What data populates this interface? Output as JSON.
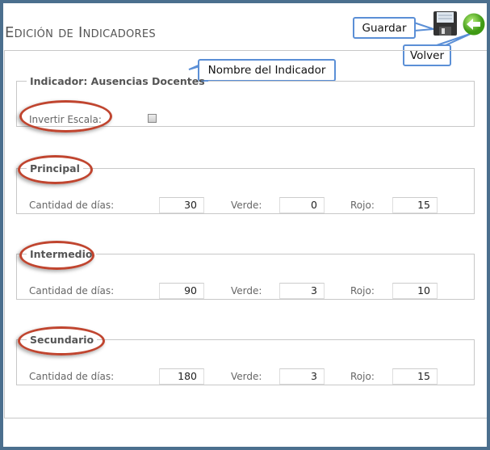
{
  "header": {
    "title": "Edición de Indicadores"
  },
  "toolbar": {
    "save_icon": "floppy-disk-icon",
    "back_icon": "green-back-arrow-icon"
  },
  "callouts": {
    "save": "Guardar",
    "back": "Volver",
    "indicator_name": "Nombre del Indicador"
  },
  "indicator": {
    "legend": "Indicador: Ausencias Docentes",
    "invert_label": "Invertir Escala:",
    "invert_checked": false
  },
  "labels": {
    "days": "Cantidad de días:",
    "green": "Verde:",
    "red": "Rojo:"
  },
  "sections": [
    {
      "legend": "Principal",
      "days": "30",
      "green": "0",
      "red": "15"
    },
    {
      "legend": "Intermedio",
      "days": "90",
      "green": "3",
      "red": "10"
    },
    {
      "legend": "Secundario",
      "days": "180",
      "green": "3",
      "red": "15"
    }
  ],
  "colors": {
    "frame": "#4b6f8e",
    "highlight": "#c0452f",
    "callout_border": "#5b8fd6"
  }
}
